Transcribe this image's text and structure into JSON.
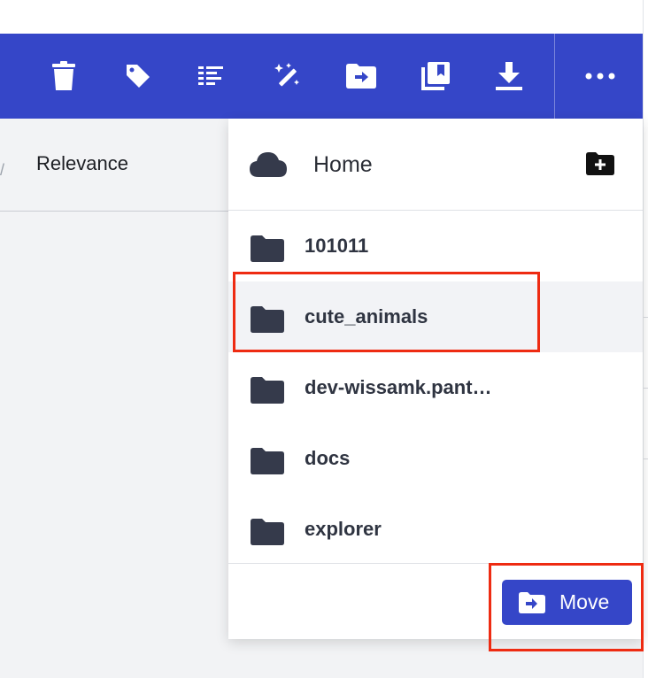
{
  "toolbar": {
    "icons": [
      "trash-icon",
      "tag-icon",
      "list-icon",
      "magic-wand-icon",
      "move-folder-icon",
      "collection-icon",
      "download-icon",
      "more-icon"
    ]
  },
  "sort": {
    "label": "Relevance"
  },
  "move_panel": {
    "home_label": "Home",
    "folders": [
      {
        "name": "101011"
      },
      {
        "name": "cute_animals"
      },
      {
        "name": "dev-wissamk.pant…"
      },
      {
        "name": "docs"
      },
      {
        "name": "explorer"
      }
    ],
    "selected_folder": "cute_animals",
    "move_button_label": "Move"
  },
  "colors": {
    "accent": "#3546c8",
    "highlight": "#ee2b12",
    "folder_icon": "#353a4b"
  }
}
